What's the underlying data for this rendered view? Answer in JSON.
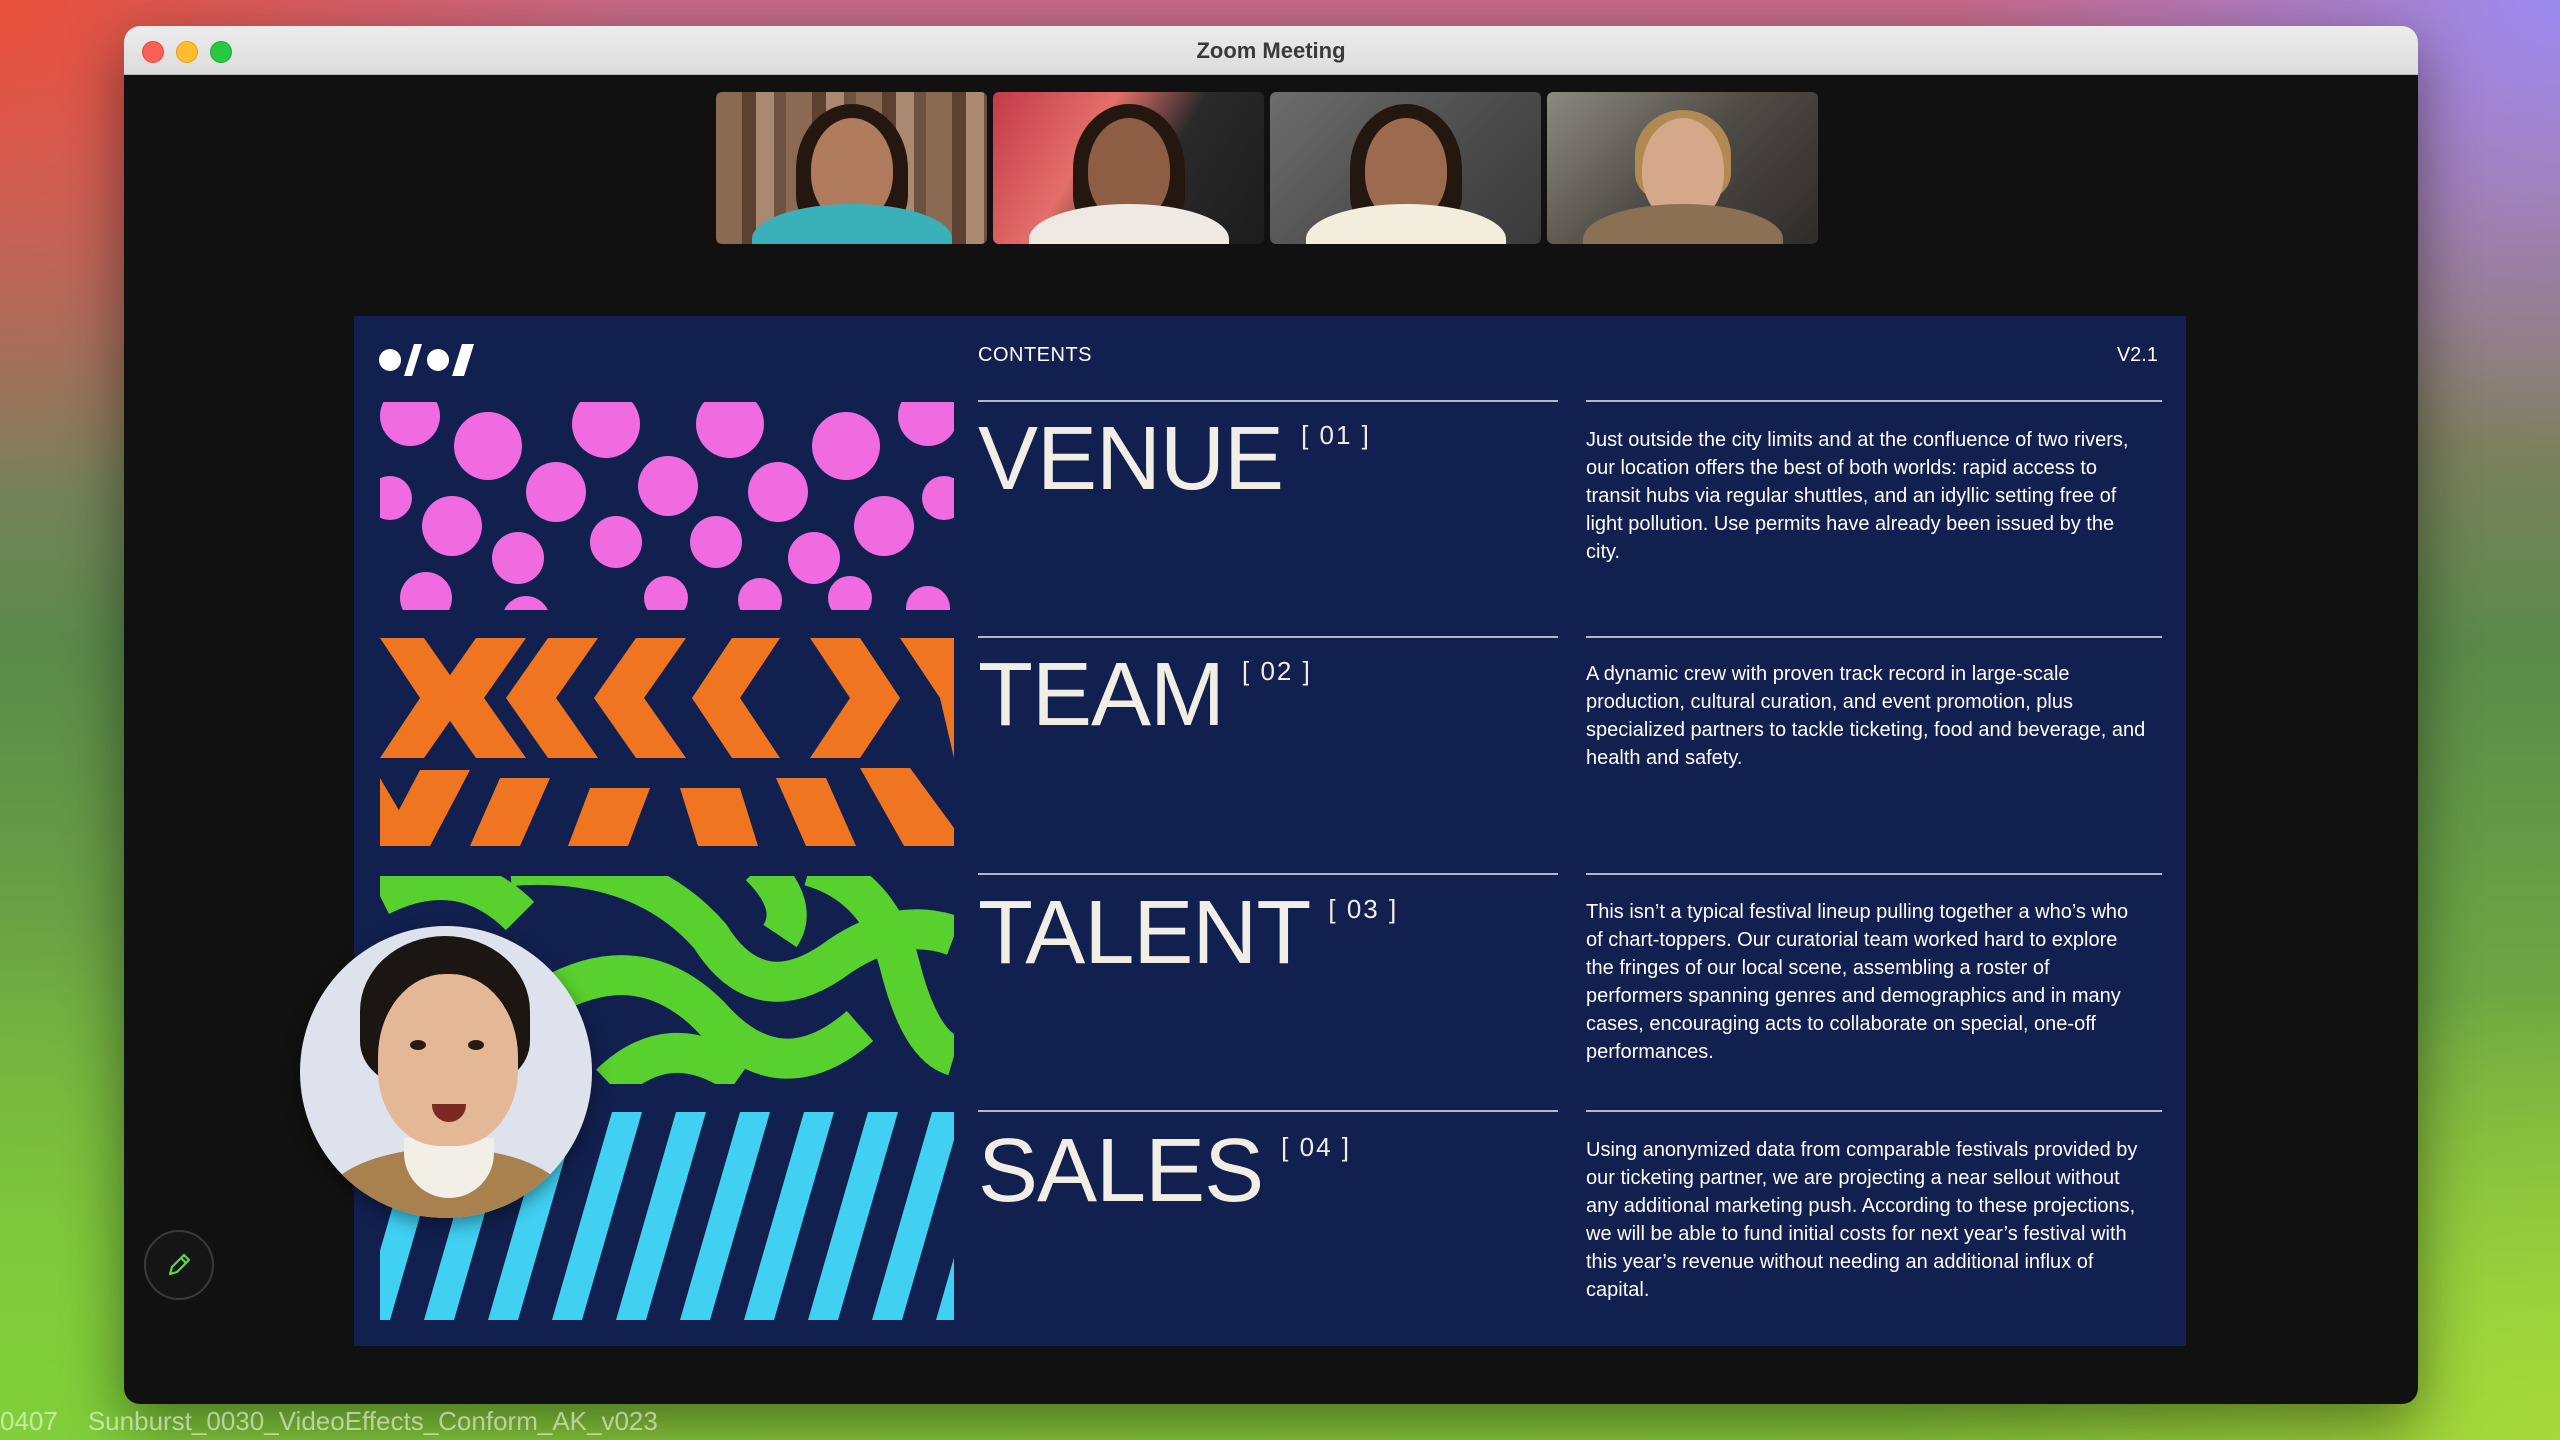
{
  "window": {
    "title": "Zoom Meeting"
  },
  "slide": {
    "header_label": "CONTENTS",
    "version": "V2.1",
    "sections": [
      {
        "title": "VENUE",
        "number": "[ 01 ]",
        "description": "Just outside the city limits and at the confluence of two rivers, our location offers the best of both worlds: rapid access to transit hubs via regular shuttles, and an idyllic setting free of light pollution. Use permits have already been issued by the city."
      },
      {
        "title": "TEAM",
        "number": "[ 02 ]",
        "description": "A dynamic crew with proven track record in large-scale production, cultural curation, and event promotion, plus specialized partners to tackle ticketing, food and beverage, and health and safety."
      },
      {
        "title": "TALENT",
        "number": "[ 03 ]",
        "description": "This isn’t a typical festival lineup pulling together a who’s who of chart-toppers. Our curatorial team worked hard to explore the fringes of our local scene, assembling a roster of performers spanning genres and demographics and in many cases, encouraging acts to collaborate on special, one-off performances."
      },
      {
        "title": "SALES",
        "number": "[ 04 ]",
        "description": "Using anonymized data from comparable festivals provided by our ticketing partner, we are projecting a near sellout without any additional marketing push. According to these projections, we will be able to fund initial costs for next year’s festival with this year’s revenue without needing an additional influx of capital."
      }
    ]
  },
  "watermark": {
    "frame": "0407",
    "filename": "Sunburst_0030_VideoEffects_Conform_AK_v023"
  },
  "colors": {
    "slide_bg": "#122050",
    "pink": "#f06ae0",
    "orange": "#f07520",
    "green": "#58d12e",
    "cyan": "#3fd0f2"
  },
  "icons": {
    "close": "close-traffic-light",
    "minimize": "minimize-traffic-light",
    "zoom": "zoom-traffic-light",
    "annotate": "pencil-icon"
  }
}
